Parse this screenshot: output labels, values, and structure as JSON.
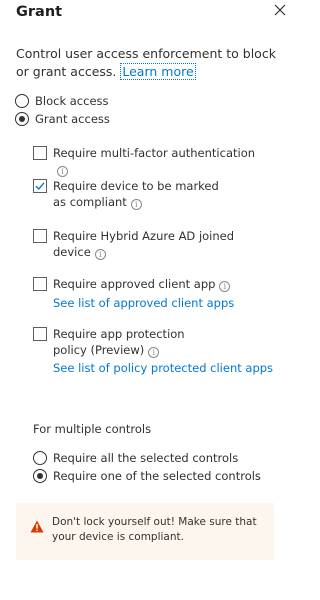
{
  "header": {
    "title": "Grant",
    "close_label": "Close"
  },
  "intro": {
    "text": "Control user access enforcement to block or grant access. ",
    "learn_more": "Learn more"
  },
  "access": {
    "options": [
      {
        "label": "Block access",
        "selected": false
      },
      {
        "label": "Grant access",
        "selected": true
      }
    ]
  },
  "controls": [
    {
      "label": "Require multi-factor authentication",
      "checked": false
    },
    {
      "label": "Require device to be marked as compliant",
      "checked": true
    },
    {
      "label": "Require Hybrid Azure AD joined device",
      "checked": false
    },
    {
      "label": "Require approved client app",
      "checked": false,
      "link": "See list of approved client apps"
    },
    {
      "label": "Require app protection policy (Preview)",
      "checked": false,
      "link": "See list of policy protected client apps"
    }
  ],
  "info_glyph": "i",
  "multiple_controls": {
    "label": "For multiple controls",
    "options": [
      {
        "label": "Require all the selected controls",
        "selected": false
      },
      {
        "label": "Require one of the selected controls",
        "selected": true
      }
    ]
  },
  "warning": {
    "text": "Don't lock yourself out! Make sure that your device is compliant.",
    "icon": "warning-icon",
    "color": "#d83b01"
  },
  "colors": {
    "link": "#0078d4",
    "checkmark": "#0078d4",
    "warning_bg": "#fdf6ee"
  }
}
